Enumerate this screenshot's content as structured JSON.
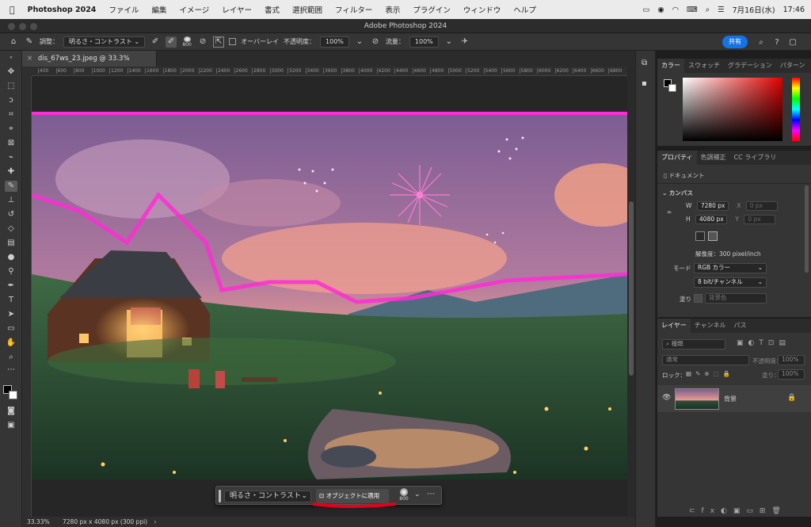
{
  "menubar": {
    "app_name": "Photoshop 2024",
    "items": [
      "ファイル",
      "編集",
      "イメージ",
      "レイヤー",
      "書式",
      "選択範囲",
      "フィルター"
    ],
    "right_items": [
      "表示",
      "プラグイン",
      "ウィンドウ",
      "ヘルプ"
    ],
    "date": "7月16日(水)",
    "time": "17:46"
  },
  "window": {
    "title": "Adobe Photoshop 2024"
  },
  "options_bar": {
    "adjust_label": "調整：",
    "adjust_value": "明るさ・コントラスト",
    "brush_size": "800",
    "overlay_label": "オーバーレイ",
    "opacity_label": "不透明度：",
    "opacity_value": "100%",
    "flow_label": "流量：",
    "flow_value": "100%",
    "share_label": "共有"
  },
  "document": {
    "tab_label": "dis_67ws_23.jpeg @ 33.3% (RGB/8#)",
    "ruler_ticks": [
      "400",
      "600",
      "800",
      "1000",
      "1200",
      "1400",
      "1600",
      "1800",
      "2000",
      "2200",
      "2400",
      "2600",
      "2800",
      "3000",
      "3200",
      "3400",
      "3600",
      "3800",
      "4000",
      "4200",
      "4400",
      "4600",
      "4800",
      "5000",
      "5200",
      "5400",
      "5600",
      "5800",
      "6000",
      "6200",
      "6400",
      "6600",
      "6800"
    ]
  },
  "status": {
    "zoom": "33.33%",
    "doc_info": "7280 px x 4080 px (300 ppi)"
  },
  "context_bar": {
    "adjust_value": "明るさ・コントラスト",
    "apply_label": "オブジェクトに適用",
    "brush_size": "800"
  },
  "color_panel": {
    "tabs": [
      "カラー",
      "スウォッチ",
      "グラデーション",
      "パターン"
    ]
  },
  "properties_panel": {
    "tabs": [
      "プロパティ",
      "色調補正",
      "CC ライブラリ"
    ],
    "doc_label": "ドキュメント",
    "canvas_section": "カンバス",
    "w_label": "W",
    "w_value": "7280 px",
    "x_label": "X",
    "x_placeholder": "0 px",
    "h_label": "H",
    "h_value": "4080 px",
    "y_label": "Y",
    "y_placeholder": "0 px",
    "resolution": "解像度：300 pixel/inch",
    "mode_label": "モード",
    "mode_value": "RGB カラー",
    "depth_value": "8 bit/チャンネル",
    "fill_label": "塗り",
    "fill_value": "背景色"
  },
  "layers_panel": {
    "tabs": [
      "レイヤー",
      "チャンネル",
      "パス"
    ],
    "filter_label": "種類",
    "blend_mode": "通常",
    "opacity_label": "不透明度：",
    "opacity_value": "100%",
    "lock_label": "ロック：",
    "fill_label": "塗り：",
    "fill_value": "100%",
    "layer_name": "背景"
  },
  "colors": {
    "accent": "#1473e6",
    "selection": "#ff2bd6",
    "annotation": "#e4001b"
  }
}
